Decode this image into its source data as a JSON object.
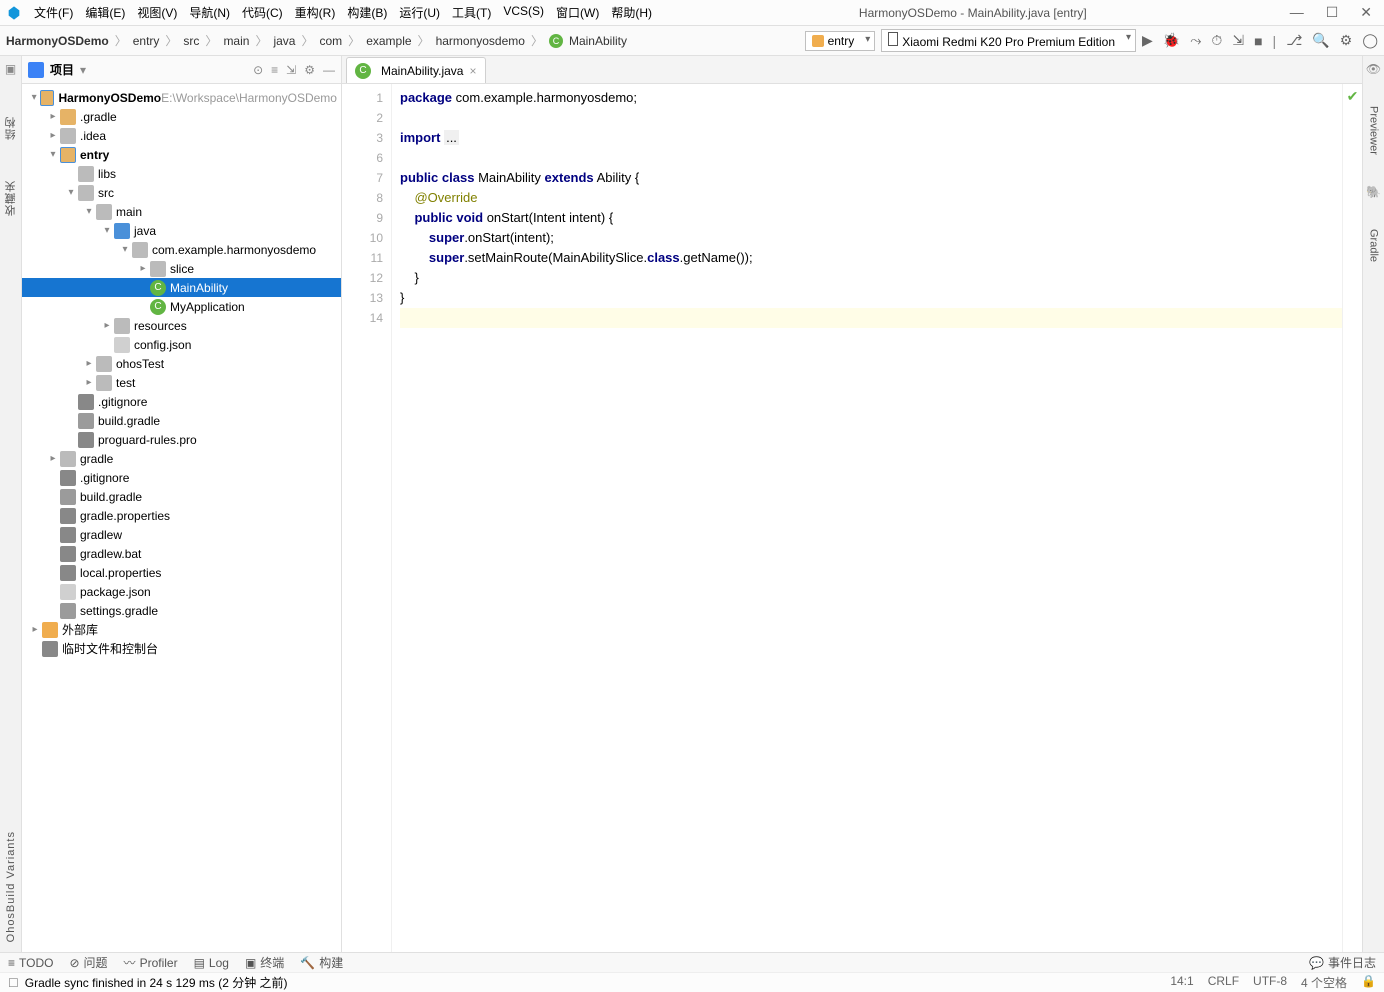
{
  "window": {
    "title": "HarmonyOSDemo - MainAbility.java [entry]",
    "menu": [
      "文件(F)",
      "编辑(E)",
      "视图(V)",
      "导航(N)",
      "代码(C)",
      "重构(R)",
      "构建(B)",
      "运行(U)",
      "工具(T)",
      "VCS(S)",
      "窗口(W)",
      "帮助(H)"
    ]
  },
  "breadcrumb": [
    "HarmonyOSDemo",
    "entry",
    "src",
    "main",
    "java",
    "com",
    "example",
    "harmonyosdemo",
    "MainAbility"
  ],
  "run_config": {
    "entry": "entry",
    "device": "Xiaomi Redmi K20 Pro Premium Edition"
  },
  "project_panel": {
    "title": "项目",
    "tree": [
      {
        "d": 0,
        "arrow": "▾",
        "icon": "module",
        "text": "HarmonyOSDemo",
        "suffix": "E:\\Workspace\\HarmonyOSDemo"
      },
      {
        "d": 1,
        "arrow": "▸",
        "icon": "folder",
        "text": ".gradle"
      },
      {
        "d": 1,
        "arrow": "▸",
        "icon": "folder-d",
        "text": ".idea"
      },
      {
        "d": 1,
        "arrow": "▾",
        "icon": "module",
        "text": "entry",
        "bold": true
      },
      {
        "d": 2,
        "arrow": "",
        "icon": "folder-d",
        "text": "libs"
      },
      {
        "d": 2,
        "arrow": "▾",
        "icon": "folder-d",
        "text": "src"
      },
      {
        "d": 3,
        "arrow": "▾",
        "icon": "folder-d",
        "text": "main"
      },
      {
        "d": 4,
        "arrow": "▾",
        "icon": "folder-b",
        "text": "java"
      },
      {
        "d": 5,
        "arrow": "▾",
        "icon": "folder-d",
        "text": "com.example.harmonyosdemo"
      },
      {
        "d": 6,
        "arrow": "▸",
        "icon": "folder-d",
        "text": "slice"
      },
      {
        "d": 6,
        "arrow": "",
        "icon": "class",
        "text": "MainAbility",
        "selected": true
      },
      {
        "d": 6,
        "arrow": "",
        "icon": "class",
        "text": "MyApplication"
      },
      {
        "d": 4,
        "arrow": "▸",
        "icon": "folder-d",
        "text": "resources"
      },
      {
        "d": 4,
        "arrow": "",
        "icon": "json",
        "text": "config.json"
      },
      {
        "d": 3,
        "arrow": "▸",
        "icon": "folder-d",
        "text": "ohosTest"
      },
      {
        "d": 3,
        "arrow": "▸",
        "icon": "folder-d",
        "text": "test"
      },
      {
        "d": 2,
        "arrow": "",
        "icon": "file",
        "text": ".gitignore"
      },
      {
        "d": 2,
        "arrow": "",
        "icon": "gradle",
        "text": "build.gradle"
      },
      {
        "d": 2,
        "arrow": "",
        "icon": "file",
        "text": "proguard-rules.pro"
      },
      {
        "d": 1,
        "arrow": "▸",
        "icon": "folder-d",
        "text": "gradle"
      },
      {
        "d": 1,
        "arrow": "",
        "icon": "file",
        "text": ".gitignore"
      },
      {
        "d": 1,
        "arrow": "",
        "icon": "gradle",
        "text": "build.gradle"
      },
      {
        "d": 1,
        "arrow": "",
        "icon": "file",
        "text": "gradle.properties"
      },
      {
        "d": 1,
        "arrow": "",
        "icon": "file",
        "text": "gradlew"
      },
      {
        "d": 1,
        "arrow": "",
        "icon": "file",
        "text": "gradlew.bat"
      },
      {
        "d": 1,
        "arrow": "",
        "icon": "file",
        "text": "local.properties"
      },
      {
        "d": 1,
        "arrow": "",
        "icon": "json",
        "text": "package.json"
      },
      {
        "d": 1,
        "arrow": "",
        "icon": "gradle",
        "text": "settings.gradle"
      },
      {
        "d": 0,
        "arrow": "▸",
        "icon": "lib",
        "text": "外部库"
      },
      {
        "d": 0,
        "arrow": "",
        "icon": "file",
        "text": "临时文件和控制台"
      }
    ]
  },
  "editor": {
    "tab_name": "MainAbility.java",
    "lines": [
      {
        "n": 1,
        "html": "<span class='kw'>package</span> com.example.harmonyosdemo;"
      },
      {
        "n": 2,
        "html": ""
      },
      {
        "n": 3,
        "html": "<span class='kw'>import</span> <span class='gray-box'>...</span>"
      },
      {
        "n": 6,
        "html": ""
      },
      {
        "n": 7,
        "html": "<span class='kw'>public</span> <span class='kw'>class</span> MainAbility <span class='kw'>extends</span> Ability {"
      },
      {
        "n": 8,
        "html": "    <span class='anno'>@Override</span>"
      },
      {
        "n": 9,
        "html": "    <span class='kw'>public</span> <span class='kw'>void</span> onStart(Intent intent) {"
      },
      {
        "n": 10,
        "html": "        <span class='kw'>super</span>.onStart(intent);"
      },
      {
        "n": 11,
        "html": "        <span class='kw'>super</span>.setMainRoute(MainAbilitySlice.<span class='kw'>class</span>.getName());"
      },
      {
        "n": 12,
        "html": "    }"
      },
      {
        "n": 13,
        "html": "}"
      },
      {
        "n": 14,
        "html": "<span class='currline'> </span>"
      }
    ]
  },
  "left_sidebar_labels": [
    "项目",
    "结构",
    "收藏夹",
    "OhosBuild Variants"
  ],
  "right_sidebar_labels": [
    "Previewer",
    "Gradle"
  ],
  "bottom_tools": [
    "TODO",
    "问题",
    "Profiler",
    "Log",
    "终端",
    "构建"
  ],
  "bottom_status_right": "事件日志",
  "status": {
    "message": "Gradle sync finished in 24 s 129 ms (2 分钟 之前)",
    "pos": "14:1",
    "eol": "CRLF",
    "encoding": "UTF-8",
    "indent": "4 个空格"
  }
}
